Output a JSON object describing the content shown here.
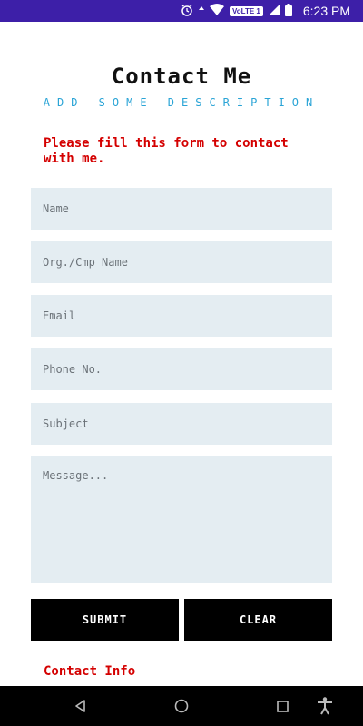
{
  "status_bar": {
    "volte": "VoLTE 1",
    "time": "6:23 PM",
    "icons": [
      "alarm-icon",
      "data-arrow-icon",
      "wifi-icon",
      "signal-icon",
      "battery-icon"
    ],
    "background": "#3d1fa8"
  },
  "header": {
    "title": "Contact Me",
    "subtitle": "ADD SOME DESCRIPTION",
    "intro": "Please fill this form to contact with me."
  },
  "form": {
    "name_placeholder": "Name",
    "org_placeholder": "Org./Cmp Name",
    "email_placeholder": "Email",
    "phone_placeholder": "Phone No.",
    "subject_placeholder": "Subject",
    "message_placeholder": "Message...",
    "field_color": "#e4edf2"
  },
  "buttons": {
    "submit_label": "SUBMIT",
    "clear_label": "CLEAR"
  },
  "footer": {
    "contact_info": "Contact Info"
  },
  "nav_bar": {
    "icons": [
      "back-icon",
      "home-icon",
      "recents-icon",
      "accessibility-icon"
    ]
  },
  "colors": {
    "accent_red": "#d40000",
    "accent_blue": "#2aa4d6",
    "button": "#000000"
  }
}
